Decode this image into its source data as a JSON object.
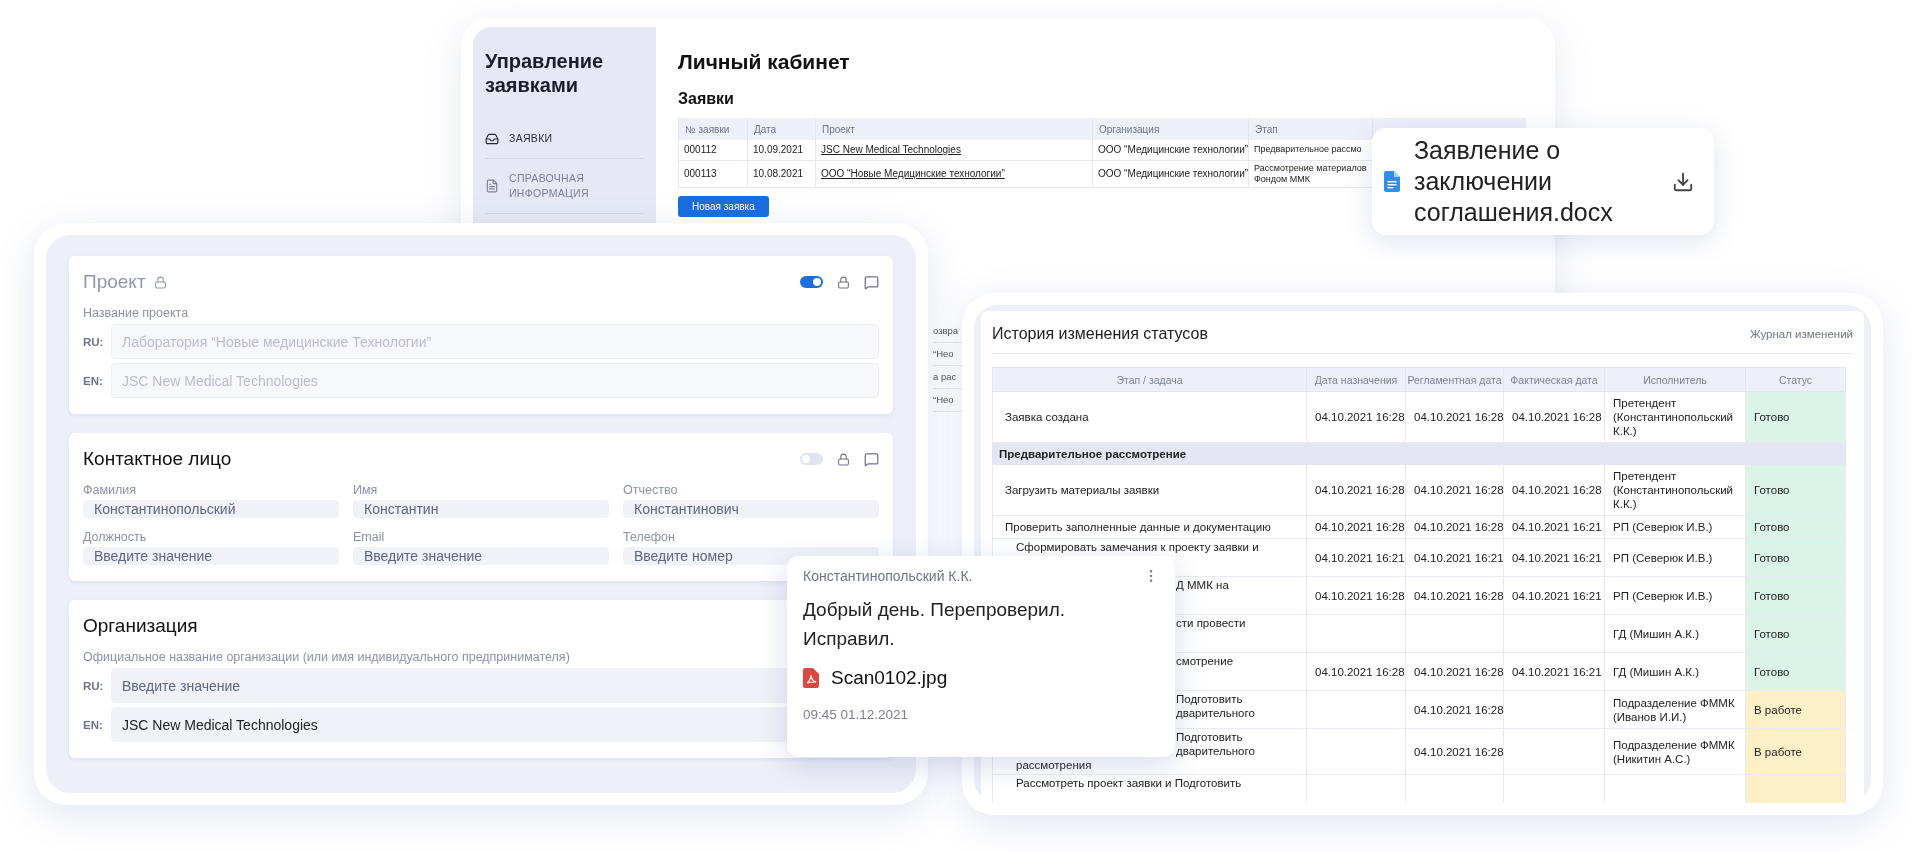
{
  "requests_window": {
    "sidebar": {
      "title": "Управление заявками",
      "items": [
        {
          "label": "ЗАЯВКИ",
          "selected": true
        },
        {
          "label": "СПРАВОЧНАЯ ИНФОРМАЦИЯ",
          "selected": false
        }
      ]
    },
    "title": "Личный кабинет",
    "section": "Заявки",
    "table": {
      "columns": [
        "№ заявки",
        "Дата",
        "Проект",
        "Организация",
        "Этап"
      ],
      "rows": [
        {
          "number": "000112",
          "date": "10.09.2021",
          "project": "JSC New Medical Technologies",
          "organization": "ООО “Медицинские технологии”",
          "stage": [
            "Предварительное рассмо"
          ]
        },
        {
          "number": "000113",
          "date": "10.08.2021",
          "project": "ООО “Новые Медицинские технологии”",
          "organization": "ООО “Медицинские технологии”",
          "stage": [
            "Рассмотрение материалов",
            "Фондом ММК"
          ]
        }
      ]
    },
    "new_button": "Новая заявка",
    "hidden_fragments": [
      "озвра",
      "“Нео",
      "а рас",
      "“Нео"
    ]
  },
  "document_card": {
    "file_name": "Заявление о заключении соглашения.docx"
  },
  "form_window": {
    "sections": [
      {
        "kind": "bilingual",
        "title": "Проект",
        "disabled": true,
        "title_locked": true,
        "actions": {
          "toggle_on": true
        },
        "field_label": "Название проекта",
        "fields": [
          {
            "lang": "RU:",
            "value": "Лаборатория “Новые медицинские Технологии”"
          },
          {
            "lang": "EN:",
            "value": "JSC New Medical Technologies"
          }
        ]
      },
      {
        "kind": "grid",
        "title": "Контактное лицо",
        "disabled": false,
        "title_locked": false,
        "actions": {
          "toggle_on": false
        },
        "fields": [
          {
            "label": "Фамилия",
            "value": "Константинопольский"
          },
          {
            "label": "Имя",
            "value": "Константин"
          },
          {
            "label": "Отчество",
            "value": "Константинович"
          },
          {
            "label": "Должность",
            "placeholder": "Введите значение"
          },
          {
            "label": "Email",
            "placeholder": "Введите значение"
          },
          {
            "label": "Телефон",
            "placeholder": "Введите номер"
          }
        ]
      },
      {
        "kind": "bilingual",
        "title": "Организация",
        "disabled": false,
        "title_locked": false,
        "field_label": "Официальное название организации (или имя индивидуального предпринимателя)",
        "fields": [
          {
            "lang": "RU:",
            "placeholder": "Введите значение"
          },
          {
            "lang": "EN:",
            "value": "JSC New Medical Technologies"
          }
        ]
      }
    ]
  },
  "history_window": {
    "title": "История изменения статусов",
    "link": "Журнал изменений",
    "columns": [
      "Этап / задача",
      "Дата назначения",
      "Регламентная дата",
      "Фактическая дата",
      "Исполнитель",
      "Статус"
    ],
    "rows": [
      {
        "kind": "step",
        "task": [
          {
            "text": "Заявка создана",
            "clipped": false
          }
        ],
        "assigned": "04.10.2021 16:28",
        "scheduled": "04.10.2021 16:28",
        "actual": "04.10.2021 16:28",
        "assignee": "Претендент (Константинопольский К.К.)",
        "status": "Готово",
        "color": "#daf4ea"
      },
      {
        "kind": "group",
        "title": "Предварительное рассмотрение"
      },
      {
        "kind": "step",
        "task": [
          {
            "text": "Загрузить материалы заявки",
            "clipped": false
          }
        ],
        "assigned": "04.10.2021 16:28",
        "scheduled": "04.10.2021 16:28",
        "actual": "04.10.2021 16:28",
        "assignee": "Претендент (Константинопольский К.К.)",
        "status": "Готово",
        "color": "#daf4ea"
      },
      {
        "kind": "step",
        "task": [
          {
            "text": "Проверить заполненные данные и документацию",
            "clipped": false
          }
        ],
        "assigned": "04.10.2021 16:28",
        "scheduled": "04.10.2021 16:28",
        "actual": "04.10.2021 16:21",
        "assignee": "РП (Северюк И.В.)",
        "status": "Готово",
        "color": "#daf4ea"
      },
      {
        "kind": "subtask",
        "task": [
          {
            "text": "Сформировать замечания к проекту заявки и",
            "clipped": false
          }
        ],
        "assigned": "04.10.2021 16:21",
        "scheduled": "04.10.2021 16:21",
        "actual": "04.10.2021 16:21",
        "assignee": "РП (Северюк И.В.)",
        "status": "Готово",
        "color": "#daf4ea"
      },
      {
        "kind": "subtask",
        "task": [
          {
            "text": "Д ММК на",
            "clipped": true
          }
        ],
        "assigned": "04.10.2021 16:28",
        "scheduled": "04.10.2021 16:28",
        "actual": "04.10.2021 16:21",
        "assignee": "РП (Северюк И.В.)",
        "status": "Готово",
        "color": "#daf4ea"
      },
      {
        "kind": "subtask",
        "task": [
          {
            "text": "сти провести",
            "clipped": true
          }
        ],
        "assignee": "ГД (Мишин А.К.)",
        "status": "Готово",
        "color": "#daf4ea"
      },
      {
        "kind": "subtask",
        "task": [
          {
            "text": "смотрение",
            "clipped": true
          }
        ],
        "assigned": "04.10.2021 16:28",
        "scheduled": "04.10.2021 16:28",
        "actual": "04.10.2021 16:21",
        "assignee": "ГД (Мишин А.К.)",
        "status": "Готово",
        "color": "#daf4ea"
      },
      {
        "kind": "subtask",
        "task": [
          {
            "text": "Подготовить",
            "clipped": true
          },
          {
            "text": "дварительного",
            "clipped": true
          }
        ],
        "scheduled": "04.10.2021 16:28",
        "assignee": "Подразделение ФММК (Иванов И.И.)",
        "status": "В работе",
        "color": "#fdf0c6"
      },
      {
        "kind": "subtask",
        "task": [
          {
            "text": "Подготовить",
            "clipped": true
          },
          {
            "text": "дварительного",
            "clipped": true
          },
          {
            "text": "рассмотрения",
            "clipped": false
          }
        ],
        "scheduled": "04.10.2021 16:28",
        "assignee": "Подразделение ФММК (Никитин А.С.)",
        "status": "В работе",
        "color": "#fdf0c6"
      },
      {
        "kind": "subtask",
        "task": [
          {
            "text": "Рассмотреть проект заявки и Подготовить",
            "clipped": false
          }
        ],
        "color": "#fdf0c6"
      }
    ]
  },
  "chat_message": {
    "author": "Константинопольский К.К.",
    "message": "Добрый день. Перепроверил. Исправил.",
    "attachment": "Scan0102.jpg",
    "time": "09:45 01.12.2021"
  }
}
